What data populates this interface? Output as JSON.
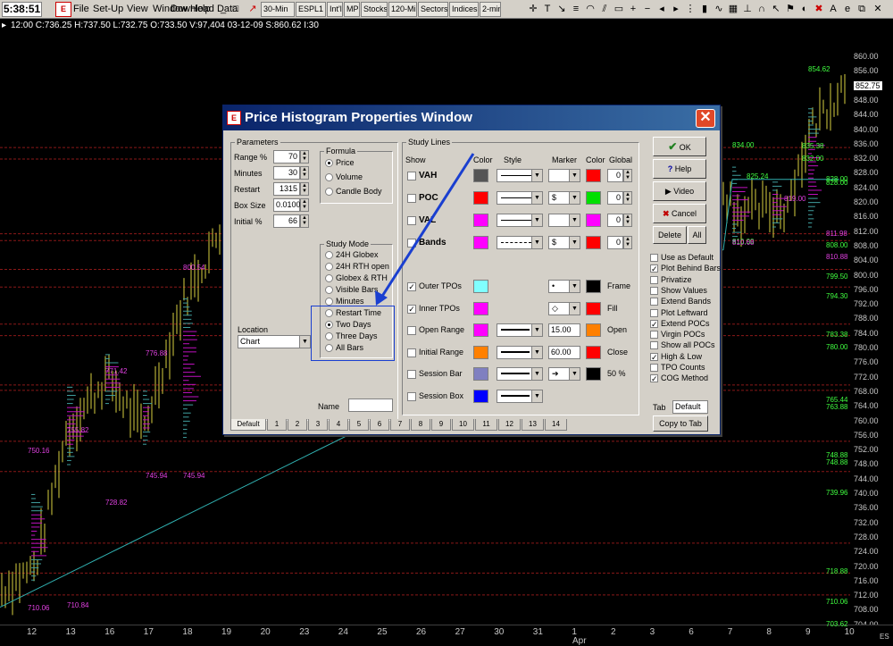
{
  "app": {
    "clock": "5:38:51",
    "menus": [
      "File",
      "Set-Up",
      "View",
      "Window",
      "Help"
    ],
    "download_label": "Download Data",
    "chart_tabs": [
      "30-Min",
      "ESPL1",
      "Int'l",
      "MP",
      "Stocks",
      "120-Min",
      "Sectors",
      "Indices",
      "2-min"
    ],
    "info": "12:00  C:736.25  H:737.50  L:732.75  O:733.50  V:97,404  03-12-09  S:860.62  I:30"
  },
  "chart": {
    "price_ticks": [
      "860.00",
      "856.00",
      "852.75",
      "848.00",
      "844.00",
      "840.00",
      "836.00",
      "832.00",
      "828.00",
      "824.00",
      "820.00",
      "816.00",
      "812.00",
      "808.00",
      "804.00",
      "800.00",
      "796.00",
      "792.00",
      "788.00",
      "784.00",
      "780.00",
      "776.00",
      "772.00",
      "768.00",
      "764.00",
      "760.00",
      "756.00",
      "752.00",
      "748.00",
      "744.00",
      "740.00",
      "736.00",
      "732.00",
      "728.00",
      "724.00",
      "720.00",
      "716.00",
      "712.00",
      "708.00",
      "704.00"
    ],
    "level_labels": [
      "854.62",
      "835.38",
      "832.00",
      "834.00",
      "825.24",
      "828.00",
      "828.00",
      "810.00",
      "808.00",
      "799.50",
      "794.30",
      "783.38",
      "780.00",
      "765.44",
      "763.88",
      "748.88",
      "748.88",
      "739.96",
      "718.88",
      "710.06",
      "703.62",
      "800.54",
      "776.88",
      "771.42",
      "755.82",
      "750.16",
      "745.94",
      "745.94",
      "728.82",
      "710.06",
      "710.84",
      "819.00",
      "811.98",
      "810.88",
      "810.68"
    ],
    "dates": [
      "12",
      "13",
      "16",
      "17",
      "18",
      "19",
      "20",
      "23",
      "24",
      "25",
      "26",
      "27",
      "30",
      "31",
      "1",
      "2",
      "3",
      "6",
      "7",
      "8",
      "9",
      "10"
    ],
    "month_label": "Apr",
    "corner_label": "ES"
  },
  "dialog": {
    "title": "Price Histogram Properties Window",
    "close": "✕",
    "parameters": {
      "group": "Parameters",
      "rows": [
        {
          "label": "Range %",
          "value": "70"
        },
        {
          "label": "Minutes",
          "value": "30"
        },
        {
          "label": "Restart",
          "value": "1315"
        },
        {
          "label": "Box Size",
          "value": "0.0100"
        },
        {
          "label": "Initial %",
          "value": "66"
        }
      ]
    },
    "formula": {
      "group": "Formula",
      "options": [
        "Price",
        "Volume",
        "Candle Body"
      ],
      "selected": 0
    },
    "study_mode": {
      "group": "Study Mode",
      "options": [
        "24H Globex",
        "24H RTH open",
        "Globex & RTH",
        "Visible Bars",
        "Minutes",
        "Restart Time",
        "Two Days",
        "Three Days",
        "All Bars"
      ],
      "selected": 6
    },
    "location": {
      "label": "Location",
      "value": "Chart"
    },
    "name_label": "Name",
    "study_lines": {
      "group": "Study Lines",
      "headers": {
        "show": "Show",
        "color": "Color",
        "style": "Style",
        "marker": "Marker",
        "color2": "Color",
        "global": "Global"
      },
      "rows": [
        {
          "label": "VAH",
          "marker": "",
          "color": "#555555",
          "color2": "#ff0000",
          "global": "0"
        },
        {
          "label": "POC",
          "marker": "$",
          "color": "#ff0000",
          "color2": "#00e000",
          "global": "0"
        },
        {
          "label": "VAL",
          "marker": "",
          "color": "#ff00ff",
          "color2": "#ff00ff",
          "global": "0"
        },
        {
          "label": "Bands",
          "marker": "$",
          "color": "#ff00ff",
          "color2": "#ff0000",
          "global": "0"
        }
      ]
    },
    "tpo": [
      {
        "label": "Outer TPOs",
        "checked": true,
        "color": "#80ffff",
        "marker": "•",
        "color2": "#000000",
        "suffix": "Frame"
      },
      {
        "label": "Inner TPOs",
        "checked": true,
        "color": "#ff00ff",
        "marker": "◇",
        "color2": "#ff0000",
        "suffix": "Fill"
      },
      {
        "label": "Open Range",
        "checked": false,
        "color": "#ff00ff",
        "value": "15.00",
        "color2": "#ff8000",
        "suffix": "Open"
      },
      {
        "label": "Initial Range",
        "checked": false,
        "color": "#ff8000",
        "value": "60.00",
        "color2": "#ff0000",
        "suffix": "Close"
      },
      {
        "label": "Session Bar",
        "checked": false,
        "color": "#8080c0",
        "marker": "➔",
        "color2": "#000000",
        "suffix": "50 %"
      },
      {
        "label": "Session Box",
        "checked": false,
        "color": "#0000ff"
      }
    ],
    "buttons": {
      "ok": "OK",
      "help": "Help",
      "video": "Video",
      "cancel": "Cancel",
      "delete": "Delete",
      "all": "All"
    },
    "options": [
      {
        "label": "Use as Default",
        "checked": false
      },
      {
        "label": "Plot Behind Bars",
        "checked": true
      },
      {
        "label": "Privatize",
        "checked": false
      },
      {
        "label": "Show Values",
        "checked": false
      },
      {
        "label": "Extend Bands",
        "checked": false
      },
      {
        "label": "Plot Leftward",
        "checked": false
      },
      {
        "label": "Extend POCs",
        "checked": true
      },
      {
        "label": "Virgin POCs",
        "checked": false
      },
      {
        "label": "Show all POCs",
        "checked": false
      },
      {
        "label": "High & Low",
        "checked": true
      },
      {
        "label": "TPO Counts",
        "checked": false
      },
      {
        "label": "COG Method",
        "checked": true
      }
    ],
    "tab_label": "Tab",
    "tab_value": "Default",
    "copy_to_tab": "Copy to Tab",
    "tabs": [
      "Default",
      "1",
      "2",
      "3",
      "4",
      "5",
      "6",
      "7",
      "8",
      "9",
      "10",
      "11",
      "12",
      "13",
      "14"
    ]
  }
}
